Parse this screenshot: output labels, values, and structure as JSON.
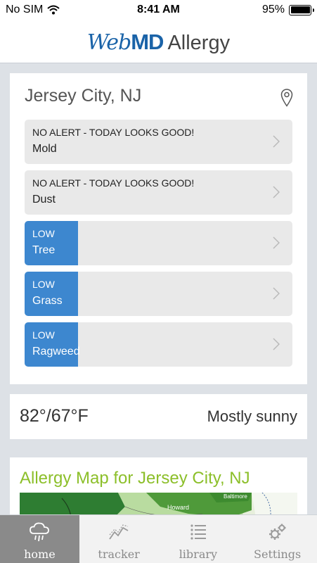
{
  "status_bar": {
    "carrier": "No SIM",
    "time": "8:41 AM",
    "battery": "95%"
  },
  "header": {
    "logo_web": "Web",
    "logo_md": "MD",
    "logo_allergy": "Allergy"
  },
  "location": {
    "title": "Jersey City, NJ",
    "items": [
      {
        "status": "NO ALERT - TODAY LOOKS GOOD!",
        "name": "Mold"
      },
      {
        "status": "NO ALERT - TODAY LOOKS GOOD!",
        "name": "Dust"
      },
      {
        "status": "LOW",
        "name": "Tree",
        "level": "low"
      },
      {
        "status": "LOW",
        "name": "Grass",
        "level": "low"
      },
      {
        "status": "LOW",
        "name": "Ragweed",
        "level": "low"
      }
    ]
  },
  "weather": {
    "temps": "82°/67°F",
    "condition": "Mostly sunny"
  },
  "map": {
    "title": "Allergy Map for Jersey City, NJ",
    "labels": [
      "Howard",
      "Baltimore"
    ]
  },
  "tabbar": {
    "tabs": [
      {
        "label": "home",
        "icon": "cloud-rain-icon",
        "active": true
      },
      {
        "label": "tracker",
        "icon": "trend-line-icon",
        "active": false
      },
      {
        "label": "library",
        "icon": "list-icon",
        "active": false
      },
      {
        "label": "Settings",
        "icon": "gears-icon",
        "active": false
      }
    ]
  },
  "colors": {
    "brand_blue": "#1a63a8",
    "low_blue": "#3d87cf",
    "map_title_green": "#8cbf2a",
    "active_tab_gray": "#8a8a8a"
  }
}
